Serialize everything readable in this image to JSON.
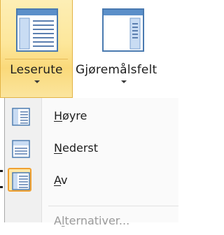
{
  "ribbon": {
    "reading_pane": {
      "label": "Leserute",
      "icon": "reading-pane-icon"
    },
    "todo_bar": {
      "label": "Gjøremålsfelt",
      "icon": "todo-bar-icon"
    }
  },
  "menu": {
    "items": [
      {
        "mnemonic": "H",
        "rest": "øyre",
        "icon": "pane-right-icon"
      },
      {
        "mnemonic": "N",
        "rest": "ederst",
        "icon": "pane-bottom-icon"
      },
      {
        "mnemonic": "A",
        "rest": "v",
        "icon": "pane-off-icon",
        "checked": true
      },
      {
        "prefix": "A",
        "mnemonic": "l",
        "rest": "ternativer...",
        "disabled": true
      }
    ]
  },
  "colors": {
    "accent_fill": "#fde79b",
    "accent_border": "#e3b446",
    "icon_blue": "#3a6ea5",
    "disabled_text": "#9a9a9a"
  }
}
